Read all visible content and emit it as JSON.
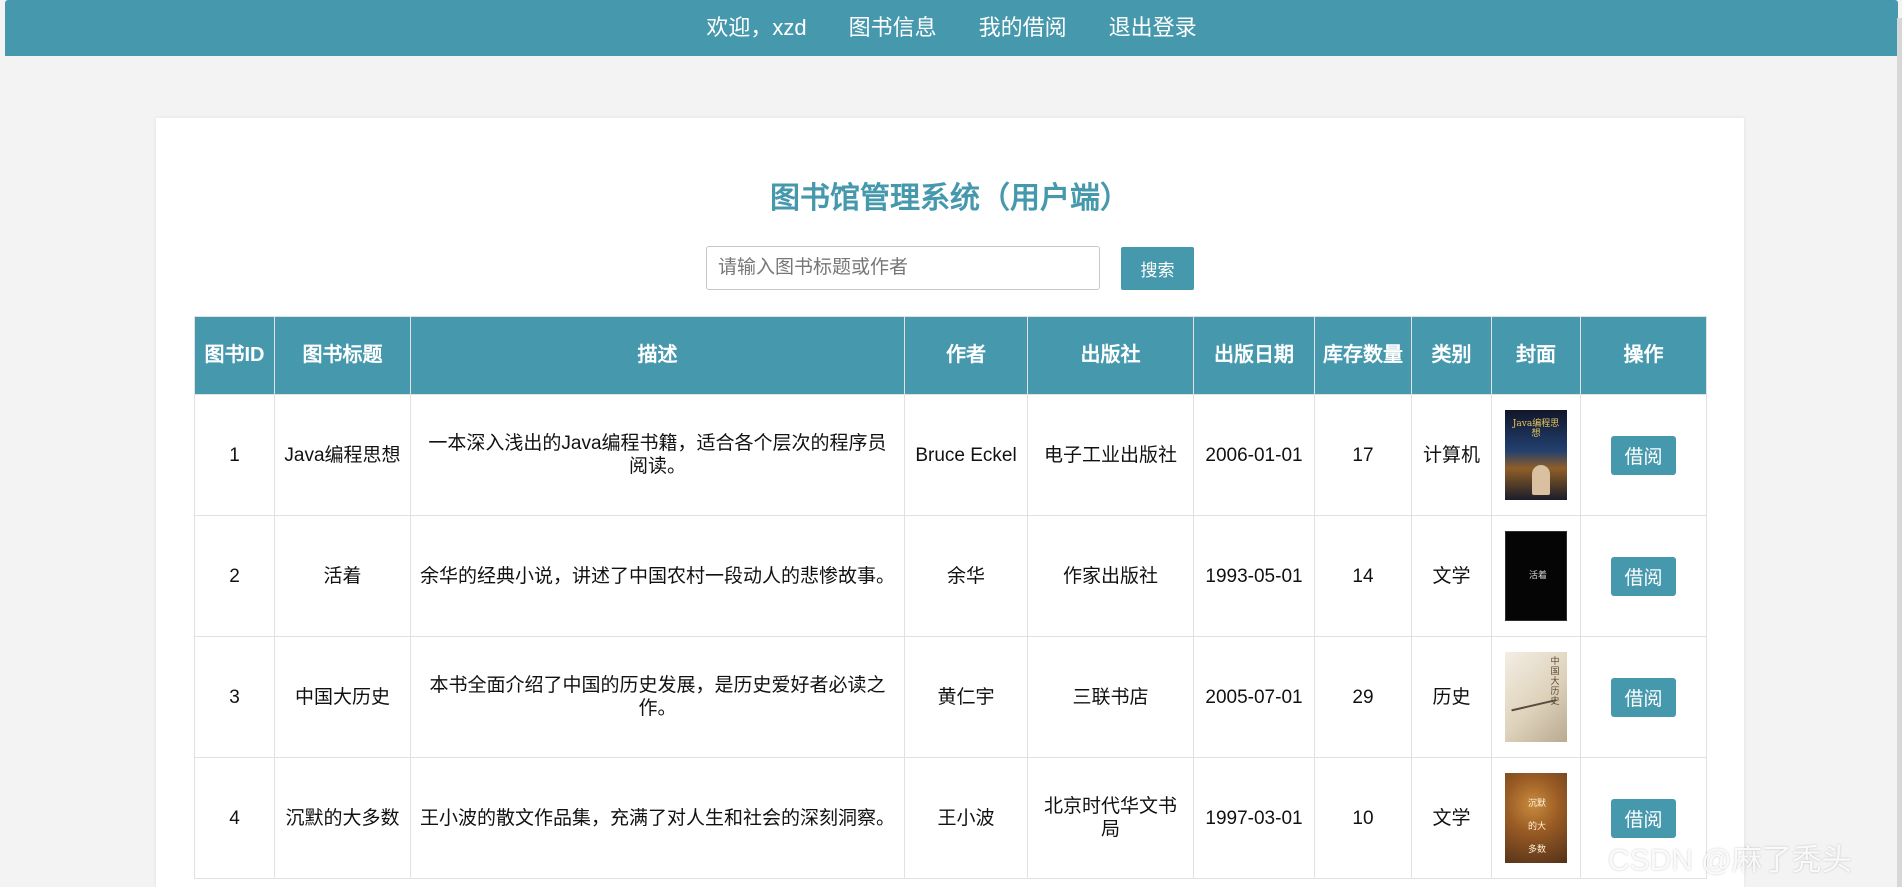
{
  "nav": {
    "welcome": "欢迎，xzd",
    "book_info": "图书信息",
    "my_borrows": "我的借阅",
    "logout": "退出登录"
  },
  "header": {
    "title": "图书馆管理系统（用户端）"
  },
  "search": {
    "placeholder": "请输入图书标题或作者",
    "button": "搜索"
  },
  "table": {
    "headers": [
      "图书ID",
      "图书标题",
      "描述",
      "作者",
      "出版社",
      "出版日期",
      "库存数量",
      "类别",
      "封面",
      "操作"
    ],
    "rows": [
      {
        "id": "1",
        "title": "Java编程思想",
        "description": "一本深入浅出的Java编程书籍，适合各个层次的程序员阅读。",
        "author": "Bruce Eckel",
        "publisher": "电子工业出版社",
        "date": "2006-01-01",
        "stock": "17",
        "category": "计算机",
        "cover_label": "Java编程思想",
        "action": "借阅"
      },
      {
        "id": "2",
        "title": "活着",
        "description": "余华的经典小说，讲述了中国农村一段动人的悲惨故事。",
        "author": "余华",
        "publisher": "作家出版社",
        "date": "1993-05-01",
        "stock": "14",
        "category": "文学",
        "cover_label": "活着",
        "action": "借阅"
      },
      {
        "id": "3",
        "title": "中国大历史",
        "description": "本书全面介绍了中国的历史发展，是历史爱好者必读之作。",
        "author": "黄仁宇",
        "publisher": "三联书店",
        "date": "2005-07-01",
        "stock": "29",
        "category": "历史",
        "cover_label": "中国大历史",
        "action": "借阅"
      },
      {
        "id": "4",
        "title": "沉默的大多数",
        "description": "王小波的散文作品集，充满了对人生和社会的深刻洞察。",
        "author": "王小波",
        "publisher": "北京时代华文书局",
        "date": "1997-03-01",
        "stock": "10",
        "category": "文学",
        "cover_label": "沉默的大多数",
        "action": "借阅"
      }
    ]
  },
  "watermark": "CSDN @麻了秃头",
  "colors": {
    "accent": "#4699ad",
    "background": "#f3f3f3",
    "panel": "#ffffff"
  }
}
